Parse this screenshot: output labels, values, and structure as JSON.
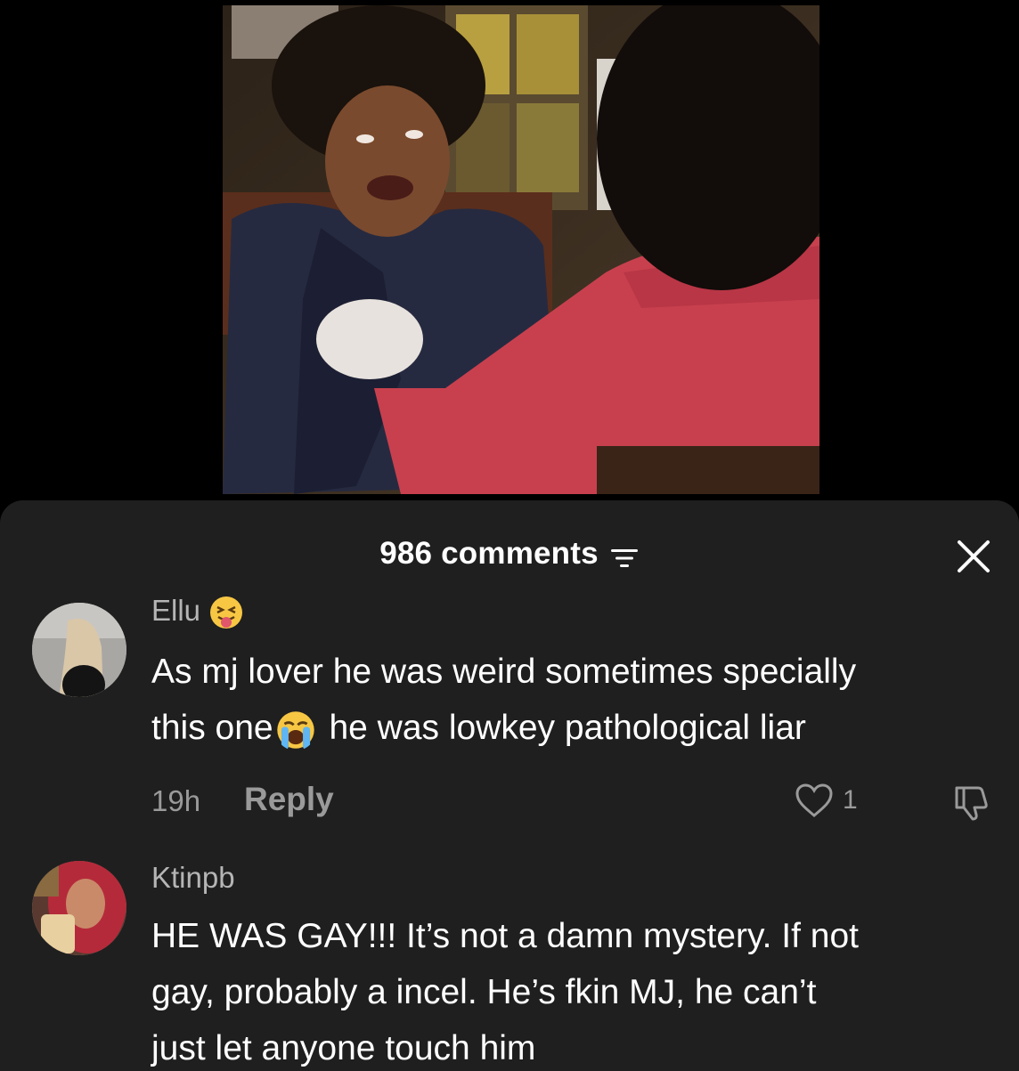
{
  "sheet": {
    "comment_count": "986 comments",
    "sort_icon": "sort-filter-icon",
    "close_icon": "close-icon"
  },
  "comments": [
    {
      "username": "Ellu",
      "username_emoji": "squinting-tongue-emoji",
      "body_part1": "As mj lover he was weird sometimes specially",
      "body_part2": "this one",
      "body_emoji": "loudly-crying-emoji",
      "body_part3": " he was lowkey pathological liar",
      "timestamp": "19h",
      "reply_label": "Reply",
      "like_count": "1"
    },
    {
      "username": "Ktinpb",
      "body_line1": "HE WAS GAY!!! It’s not a damn mystery. If not",
      "body_line2": "gay, probably a incel. He’s fkin MJ, he can’t",
      "body_line3": "just let anyone touch him"
    }
  ],
  "colors": {
    "sheet_bg": "#1f1f1f",
    "muted_text": "#9a9a9a",
    "username_text": "#b5b5b5"
  }
}
